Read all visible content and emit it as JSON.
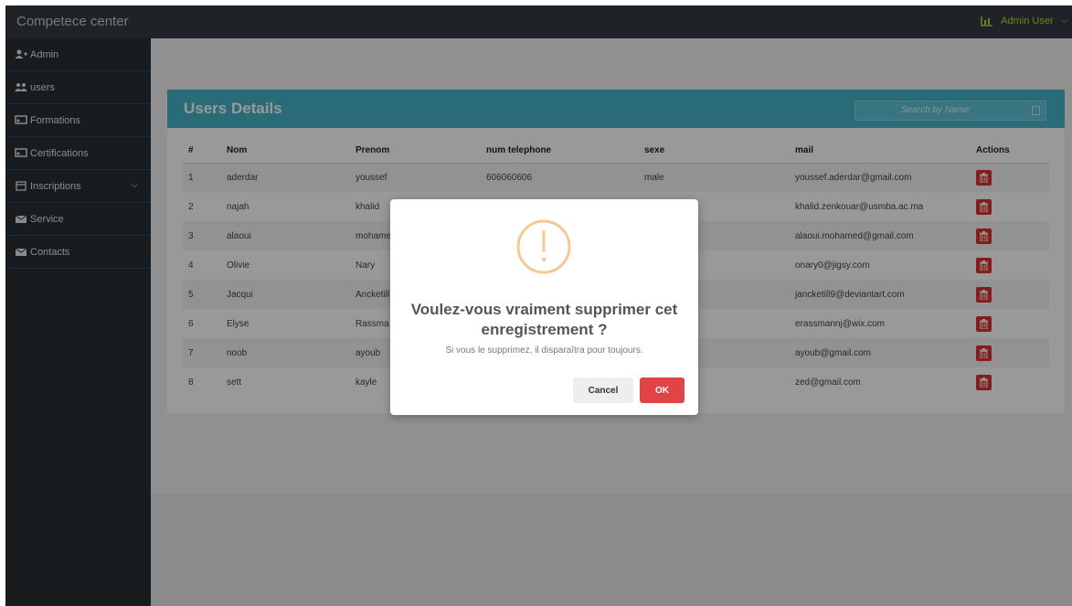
{
  "topbar": {
    "brand": "Competece center",
    "user": "Admin User"
  },
  "sidebar": {
    "items": [
      {
        "label": "Admin"
      },
      {
        "label": "users"
      },
      {
        "label": "Formations"
      },
      {
        "label": "Certifications"
      },
      {
        "label": "Inscriptions"
      },
      {
        "label": "Service"
      },
      {
        "label": "Contacts"
      }
    ]
  },
  "card": {
    "title": "Users Details",
    "search_placeholder": "Search by Name"
  },
  "table": {
    "headers": [
      "#",
      "Nom",
      "Prenom",
      "num telephone",
      "sexe",
      "mail",
      "Actions"
    ],
    "rows": [
      {
        "id": "1",
        "nom": "aderdar",
        "prenom": "youssef",
        "tel": "606060606",
        "sexe": "male",
        "mail": "youssef.aderdar@gmail.com"
      },
      {
        "id": "2",
        "nom": "najah",
        "prenom": "khalid",
        "tel": "",
        "sexe": "",
        "mail": "khalid.zenkouar@usmba.ac.ma"
      },
      {
        "id": "3",
        "nom": "alaoui",
        "prenom": "mohame",
        "tel": "",
        "sexe": "",
        "mail": "alaoui.mohamed@gmail.com"
      },
      {
        "id": "4",
        "nom": "Olivie",
        "prenom": "Nary",
        "tel": "",
        "sexe": "",
        "mail": "onary0@jigsy.com"
      },
      {
        "id": "5",
        "nom": "Jacqui",
        "prenom": "Ancketill",
        "tel": "",
        "sexe": "",
        "mail": "jancketill9@deviantart.com"
      },
      {
        "id": "6",
        "nom": "Elyse",
        "prenom": "Rassma",
        "tel": "",
        "sexe": "",
        "mail": "erassmannj@wix.com"
      },
      {
        "id": "7",
        "nom": "noob",
        "prenom": "ayoub",
        "tel": "",
        "sexe": "",
        "mail": "ayoub@gmail.com"
      },
      {
        "id": "8",
        "nom": "sett",
        "prenom": "kayle",
        "tel": "",
        "sexe": "",
        "mail": "zed@gmail.com"
      }
    ]
  },
  "modal": {
    "title": "Voulez-vous vraiment supprimer cet enregistrement ?",
    "text": "Si vous le supprimez, il disparaîtra pour toujours.",
    "cancel_label": "Cancel",
    "ok_label": "OK"
  },
  "colors": {
    "accent": "#46b3c8",
    "danger": "#e03131",
    "warning": "#f5c990",
    "sidebar": "#2b3035"
  },
  "icons": {
    "admin": "user-plus-icon",
    "users": "users-icon",
    "formations": "chalkboard-icon",
    "certifications": "chalkboard-icon",
    "inscriptions": "calendar-icon",
    "service": "envelope-icon",
    "contacts": "envelope-icon",
    "actions": "trash-icon",
    "topbar": "chart-icon",
    "modal": "warning-icon"
  }
}
